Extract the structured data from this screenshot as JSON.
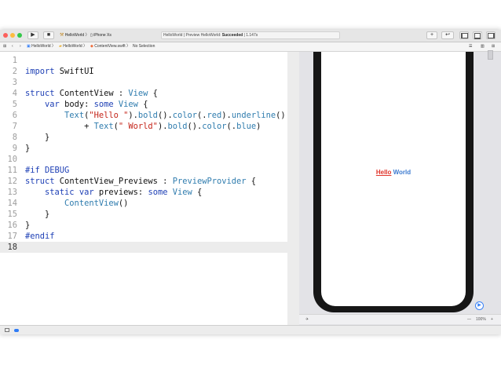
{
  "toolbar": {
    "run_icon": "play-icon",
    "stop_icon": "stop-icon",
    "scheme_target": "HelloWorld",
    "scheme_device": "iPhone Xs",
    "status_prefix": "HelloWorld | Preview HelloWorld: ",
    "status_result": "Succeeded",
    "status_suffix": " | 1.147s",
    "add_label": "+",
    "back_forward_label": "↩"
  },
  "jumpbar": {
    "crumbs": [
      "HelloWorld",
      "HelloWorld",
      "ContentView.swift",
      "No Selection"
    ],
    "separator": "〉"
  },
  "editor": {
    "lines": [
      {
        "n": "1"
      },
      {
        "n": "2"
      },
      {
        "n": "3"
      },
      {
        "n": "4"
      },
      {
        "n": "5"
      },
      {
        "n": "6"
      },
      {
        "n": "7"
      },
      {
        "n": "8"
      },
      {
        "n": "9"
      },
      {
        "n": "10"
      },
      {
        "n": "11"
      },
      {
        "n": "12"
      },
      {
        "n": "13"
      },
      {
        "n": "14"
      },
      {
        "n": "15"
      },
      {
        "n": "16"
      },
      {
        "n": "17"
      },
      {
        "n": "18"
      }
    ],
    "tokens": {
      "import": "import",
      "swiftui": " SwiftUI",
      "struct": "struct",
      "contentview_decl": " ContentView : ",
      "view": "View",
      "brace_open": " {",
      "brace_close": "}",
      "var": "var",
      "body_decl": " body: ",
      "some": "some",
      "text": "Text",
      "hello_str": "\"Hello \"",
      "bold": "bold",
      "color": "color",
      "red": "red",
      "underline": "underline",
      "plus": "+ ",
      "world_str": "\" World\"",
      "blue": "blue",
      "if_debug": "#if DEBUG",
      "previews_decl": " ContentView_Previews : ",
      "preview_provider": "PreviewProvider",
      "static": "static",
      "previews_var": " previews: ",
      "content_view_call": "ContentView",
      "endif": "#endif"
    }
  },
  "preview": {
    "hello": "Hello",
    "world": " World",
    "live_icon": "live-preview-icon",
    "zoom": "100%",
    "zoom_out": "—",
    "zoom_in": "+",
    "pin_icon": "pin-icon"
  },
  "colors": {
    "keyword": "#1d3fb5",
    "type": "#2f7cae",
    "string": "#c4251a",
    "hello_red": "#e0352b",
    "world_blue": "#3d7bd0"
  }
}
